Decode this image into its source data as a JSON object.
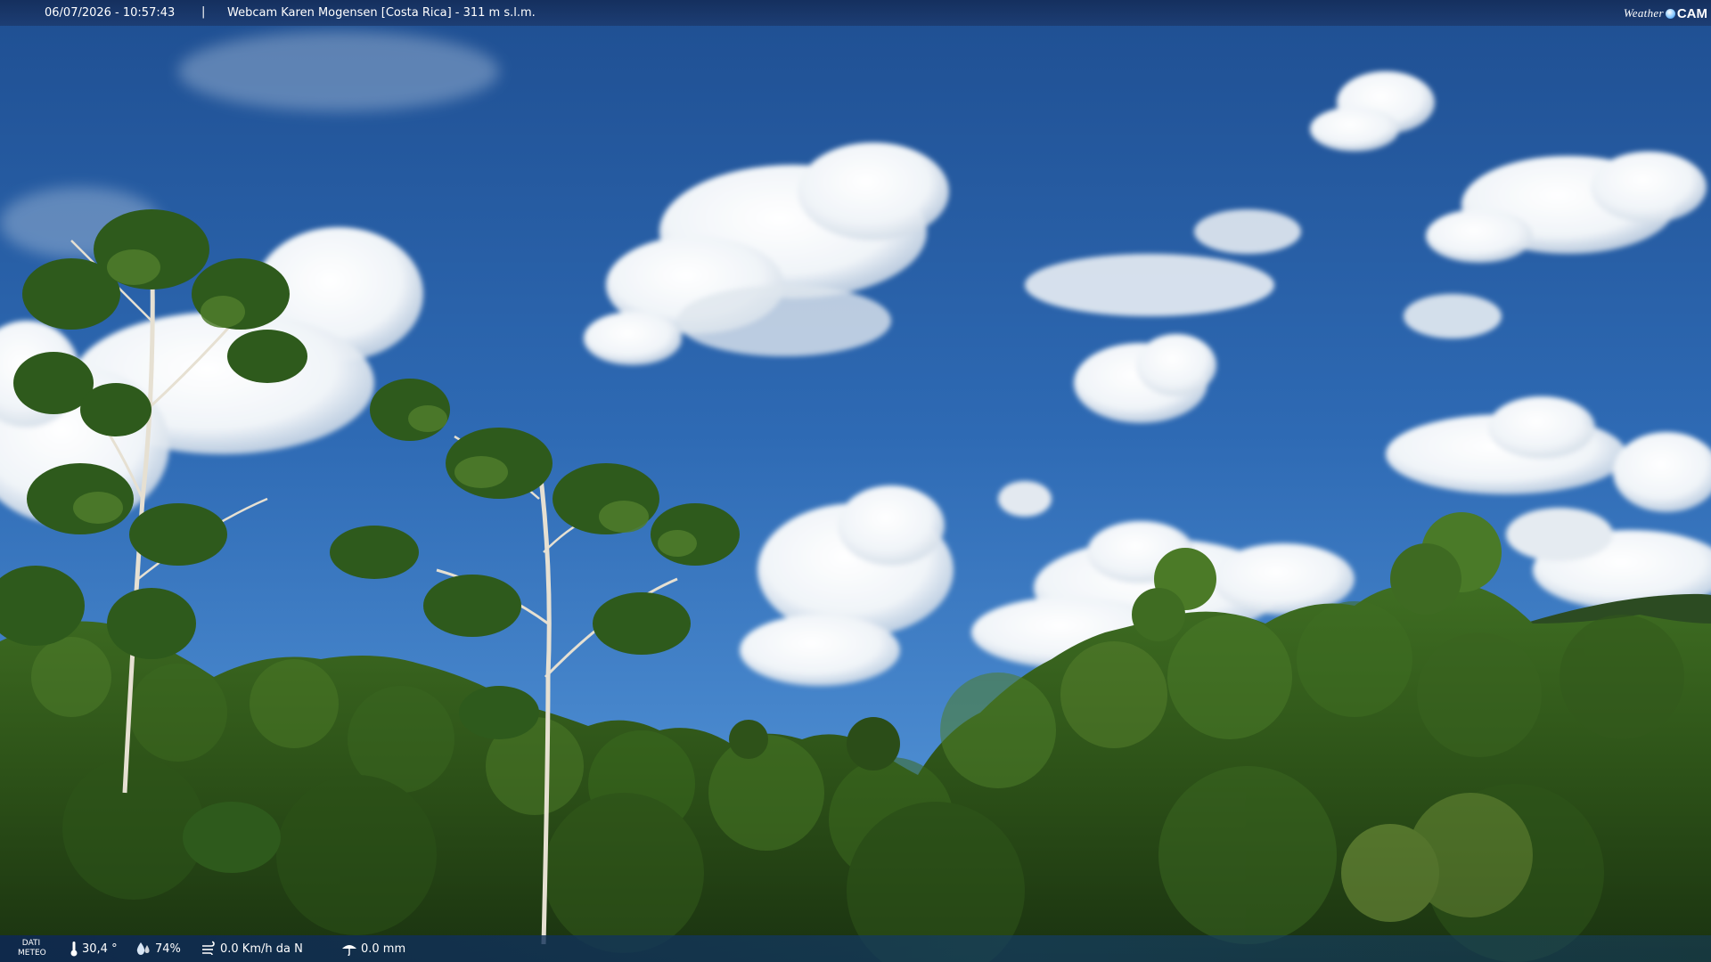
{
  "header": {
    "datetime": "06/07/2026 - 10:57:43",
    "separator": "|",
    "title": "Webcam Karen Mogensen [Costa Rica]  - 311 m s.l.m.",
    "logo": {
      "word1": "Weather",
      "word2": "CAM",
      "icon": "globe-icon"
    }
  },
  "footer": {
    "dati_line1": "DATI",
    "dati_line2": "METEO",
    "temperature": "30,4 °",
    "humidity": "74%",
    "wind": "0.0 Km/h da N",
    "rain": "0.0 mm",
    "icons": {
      "temperature": "thermometer-icon",
      "humidity": "humidity-drop-icon",
      "wind": "wind-icon",
      "rain": "rain-gauge-icon"
    }
  },
  "colors": {
    "sky_top": "#245a9e",
    "sky_horizon": "#4b8bd0",
    "foliage_dark": "#1f3d18",
    "foliage_light": "#4f7d2a",
    "bar": "#1a3a6e"
  }
}
